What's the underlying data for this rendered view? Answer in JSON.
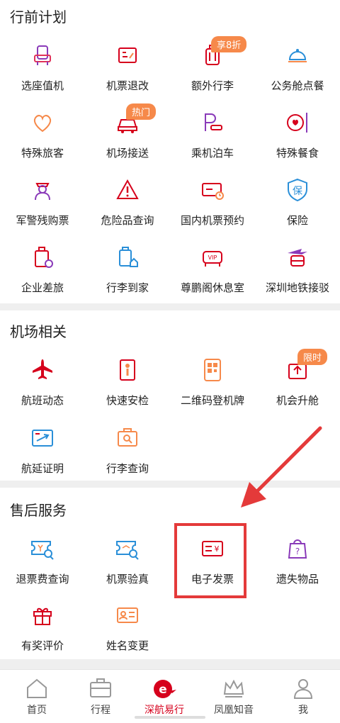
{
  "sections": [
    {
      "title": "行前计划"
    },
    {
      "title": "机场相关"
    },
    {
      "title": "售后服务"
    }
  ],
  "pre_trip": [
    {
      "label": "选座值机",
      "icon": "seat-icon"
    },
    {
      "label": "机票退改",
      "icon": "ticket-change-icon"
    },
    {
      "label": "额外行李",
      "icon": "extra-luggage-icon",
      "badge": "享8折"
    },
    {
      "label": "公务舱点餐",
      "icon": "cloche-icon"
    },
    {
      "label": "特殊旅客",
      "icon": "heart-icon"
    },
    {
      "label": "机场接送",
      "icon": "car-icon",
      "badge": "热门"
    },
    {
      "label": "乘机泊车",
      "icon": "parking-icon"
    },
    {
      "label": "特殊餐食",
      "icon": "meal-icon"
    },
    {
      "label": "军警残购票",
      "icon": "officer-icon"
    },
    {
      "label": "危险品查询",
      "icon": "warning-icon"
    },
    {
      "label": "国内机票预约",
      "icon": "ticket-clock-icon"
    },
    {
      "label": "保险",
      "icon": "shield-icon",
      "glyph": "保"
    },
    {
      "label": "企业差旅",
      "icon": "suitcase-icon"
    },
    {
      "label": "行李到家",
      "icon": "luggage-home-icon"
    },
    {
      "label": "尊鹏阁休息室",
      "icon": "vip-sofa-icon",
      "glyph": "VIP"
    },
    {
      "label": "深圳地铁接驳",
      "icon": "metro-icon"
    }
  ],
  "airport": [
    {
      "label": "航班动态",
      "icon": "plane-icon"
    },
    {
      "label": "快速安检",
      "icon": "security-check-icon"
    },
    {
      "label": "二维码登机牌",
      "icon": "qr-code-icon"
    },
    {
      "label": "机会升舱",
      "icon": "upgrade-icon",
      "badge": "限时"
    },
    {
      "label": "航延证明",
      "icon": "delay-cert-icon"
    },
    {
      "label": "行李查询",
      "icon": "luggage-search-icon"
    }
  ],
  "after_sales": [
    {
      "label": "退票费查询",
      "icon": "refund-search-icon"
    },
    {
      "label": "机票验真",
      "icon": "ticket-verify-icon"
    },
    {
      "label": "电子发票",
      "icon": "e-invoice-icon",
      "glyph": "¥"
    },
    {
      "label": "遗失物品",
      "icon": "lost-bag-icon",
      "glyph": "?"
    },
    {
      "label": "有奖评价",
      "icon": "gift-icon"
    },
    {
      "label": "姓名变更",
      "icon": "name-card-icon"
    }
  ],
  "tabs": [
    {
      "label": "首页",
      "icon": "home-icon"
    },
    {
      "label": "行程",
      "icon": "trip-icon"
    },
    {
      "label": "深航易行",
      "icon": "brand-e-icon",
      "active": true,
      "glyph": "e"
    },
    {
      "label": "凤凰知音",
      "icon": "crown-icon"
    },
    {
      "label": "我",
      "icon": "user-icon"
    }
  ],
  "colors": {
    "red": "#d6001c",
    "purple": "#8a3ab9",
    "orange": "#f6894a",
    "blue": "#2a8fd8",
    "annotation": "#e43a3a"
  }
}
